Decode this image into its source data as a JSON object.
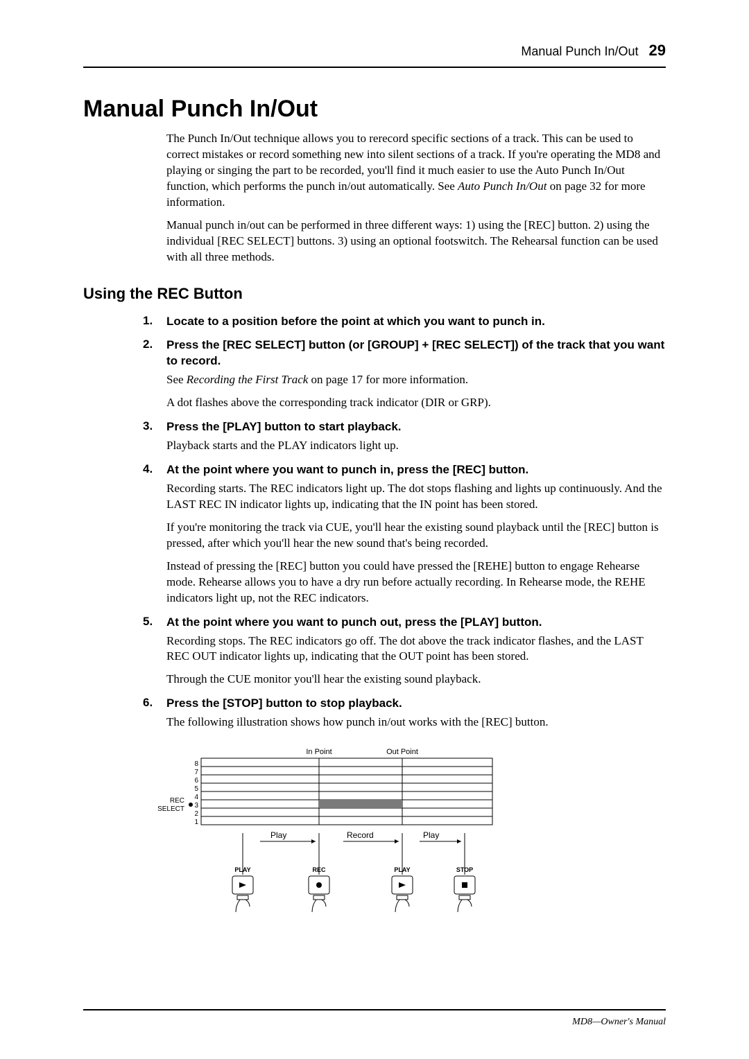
{
  "header": {
    "title": "Manual Punch In/Out",
    "page_number": "29"
  },
  "section_title": "Manual Punch In/Out",
  "intro1": "The Punch In/Out technique allows you to rerecord specific sections of a track. This can be used to correct mistakes or record something new into silent sections of a track. If you're operating the MD8 and playing or singing the part to be recorded, you'll find it much easier to use the Auto Punch In/Out function, which performs the punch in/out automatically. See ",
  "intro1_ref": "Auto Punch In/Out",
  "intro1_tail": " on page 32 for more information.",
  "intro2": "Manual punch in/out can be performed in three different ways: 1) using the [REC] button. 2) using the individual [REC SELECT] buttons. 3) using an optional footswitch. The Rehearsal function can be used with all three methods.",
  "subhead": "Using the REC Button",
  "steps": [
    {
      "num": "1.",
      "title": "Locate to a position before the point at which you want to punch in.",
      "paras": []
    },
    {
      "num": "2.",
      "title": "Press the [REC SELECT] button (or [GROUP] + [REC SELECT]) of the track that you want to record.",
      "paras": [
        {
          "pre": "See ",
          "em": "Recording the First Track",
          "post": " on page 17 for more information."
        },
        {
          "text": "A dot flashes above the corresponding track indicator (DIR or GRP)."
        }
      ]
    },
    {
      "num": "3.",
      "title": "Press the [PLAY] button to start playback.",
      "paras": [
        {
          "text": "Playback starts and the PLAY indicators light up."
        }
      ]
    },
    {
      "num": "4.",
      "title": "At the point where you want to punch in, press the [REC] button.",
      "paras": [
        {
          "text": "Recording starts. The REC indicators light up. The dot stops flashing and lights up continuously. And the LAST REC IN indicator lights up, indicating that the IN point has been stored."
        },
        {
          "text": "If you're monitoring the track via CUE, you'll hear the existing sound playback until the [REC] button is pressed, after which you'll hear the new sound that's being recorded."
        },
        {
          "text": "Instead of pressing the [REC] button you could have pressed the [REHE] button to engage Rehearse mode. Rehearse allows you to have a dry run before actually recording. In Rehearse mode, the REHE indicators light up, not the REC indicators."
        }
      ]
    },
    {
      "num": "5.",
      "title": "At the point where you want to punch out, press the [PLAY] button.",
      "paras": [
        {
          "text": "Recording stops. The REC indicators go off. The dot above the track indicator flashes, and the LAST REC OUT indicator lights up, indicating that the OUT point has been stored."
        },
        {
          "text": "Through the CUE monitor you'll hear the existing sound playback."
        }
      ]
    },
    {
      "num": "6.",
      "title": "Press the [STOP] button to stop playback.",
      "paras": [
        {
          "text": "The following illustration shows how punch in/out works with the [REC] button."
        }
      ]
    }
  ],
  "diagram": {
    "in_point": "In Point",
    "out_point": "Out Point",
    "tracks": [
      "1",
      "2",
      "3",
      "4",
      "5",
      "6",
      "7",
      "8"
    ],
    "rec_select": "REC\nSELECT",
    "phase_play1": "Play",
    "phase_record": "Record",
    "phase_play2": "Play",
    "btn_play": "PLAY",
    "btn_rec": "REC",
    "btn_stop": "STOP"
  },
  "footer": "MD8—Owner's Manual"
}
